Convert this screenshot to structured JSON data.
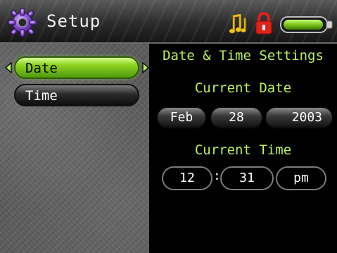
{
  "header": {
    "title": "Setup",
    "icons": [
      "gear-icon",
      "music-notes-icon",
      "lock-icon",
      "battery-icon"
    ],
    "battery_level": 0.85
  },
  "menu": {
    "items": [
      {
        "label": "Date",
        "selected": true
      },
      {
        "label": "Time",
        "selected": false
      }
    ]
  },
  "panel": {
    "title": "Date & Time Settings",
    "date_heading": "Current Date",
    "date": {
      "month": "Feb",
      "day": "28",
      "year": "2003"
    },
    "time_heading": "Current Time",
    "time": {
      "hour": "12",
      "separator": ":",
      "minute": "31",
      "ampm": "pm"
    }
  },
  "colors": {
    "accent": "#b9f05e",
    "selected_green": "#8fd41f",
    "lock_red": "#e2211c",
    "battery_green": "#7cc41a"
  }
}
